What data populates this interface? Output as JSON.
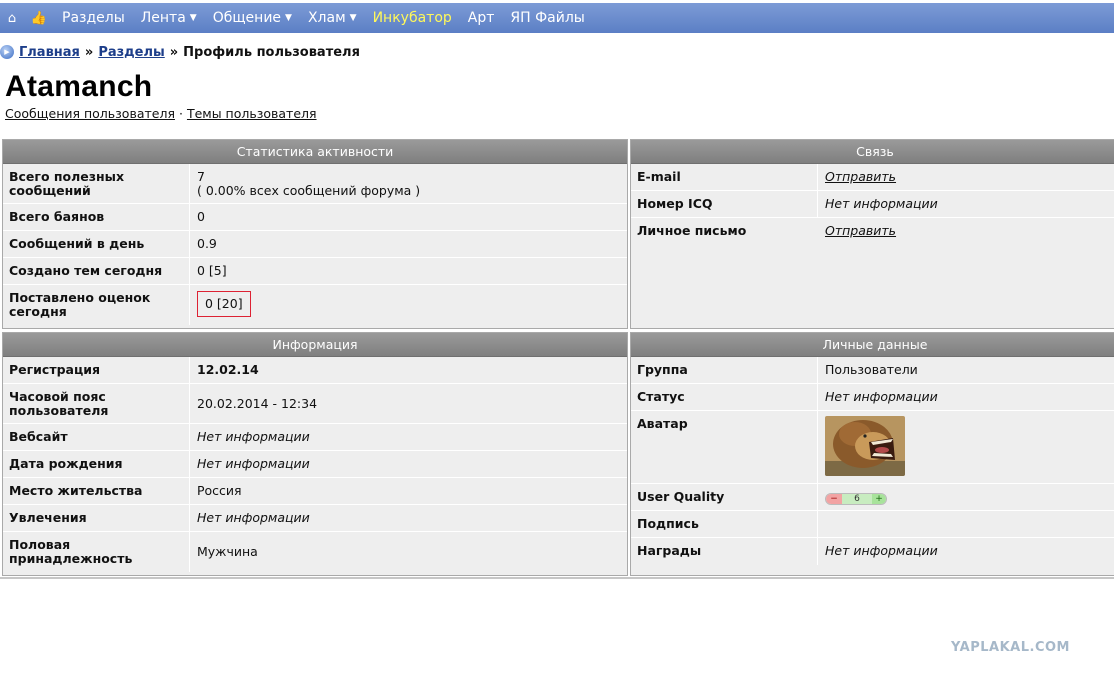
{
  "nav": {
    "items": [
      {
        "label": "Разделы",
        "caret": false,
        "highlight": false
      },
      {
        "label": "Лента",
        "caret": true,
        "highlight": false
      },
      {
        "label": "Общение",
        "caret": true,
        "highlight": false
      },
      {
        "label": "Хлам",
        "caret": true,
        "highlight": false
      },
      {
        "label": "Инкубатор",
        "caret": false,
        "highlight": true
      },
      {
        "label": "Арт",
        "caret": false,
        "highlight": false
      },
      {
        "label": "ЯП Файлы",
        "caret": false,
        "highlight": false
      }
    ],
    "home_icon": "⌂",
    "like_icon": "👍"
  },
  "breadcrumb": {
    "home": "Главная",
    "sep": "»",
    "sections": "Разделы",
    "current": "Профиль пользователя"
  },
  "user": {
    "name": "Atamanch",
    "messages_link": "Сообщения пользователя",
    "dot": "·",
    "topics_link": "Темы пользователя"
  },
  "stats": {
    "title": "Статистика активности",
    "rows": [
      {
        "k": "Всего полезных сообщений",
        "v": "7",
        "v2": "( 0.00% всех сообщений форума )"
      },
      {
        "k": "Всего баянов",
        "v": "0"
      },
      {
        "k": "Сообщений в день",
        "v": "0.9"
      },
      {
        "k": "Создано тем сегодня",
        "v": "0 [5]"
      },
      {
        "k": "Поставлено оценок сегодня",
        "v": "0 [20]"
      }
    ]
  },
  "contact": {
    "title": "Связь",
    "rows": [
      {
        "k": "E-mail",
        "v": "Отправить"
      },
      {
        "k": "Номер ICQ",
        "v": "Нет информации"
      },
      {
        "k": "Личное письмо",
        "v": "Отправить"
      }
    ]
  },
  "info": {
    "title": "Информация",
    "rows": [
      {
        "k": "Регистрация",
        "v": "12.02.14"
      },
      {
        "k": "Часовой пояс пользователя",
        "v": "20.02.2014 - 12:34"
      },
      {
        "k": "Вебсайт",
        "v": "Нет информации"
      },
      {
        "k": "Дата рождения",
        "v": "Нет информации"
      },
      {
        "k": "Место жительства",
        "v": "Россия"
      },
      {
        "k": "Увлечения",
        "v": "Нет информации"
      },
      {
        "k": "Половая принадлежность",
        "v": "Мужчина"
      }
    ]
  },
  "personal": {
    "title": "Личные данные",
    "rows": [
      {
        "k": "Группа",
        "v": "Пользователи"
      },
      {
        "k": "Статус",
        "v": "Нет информации"
      },
      {
        "k": "Аватар",
        "v": ""
      },
      {
        "k": "User Quality",
        "v": ""
      },
      {
        "k": "Подпись",
        "v": ""
      },
      {
        "k": "Награды",
        "v": "Нет информации"
      }
    ],
    "quality": {
      "minus": "−",
      "value": "6",
      "plus": "+"
    }
  },
  "watermark": "YAPLAKAL.COM"
}
